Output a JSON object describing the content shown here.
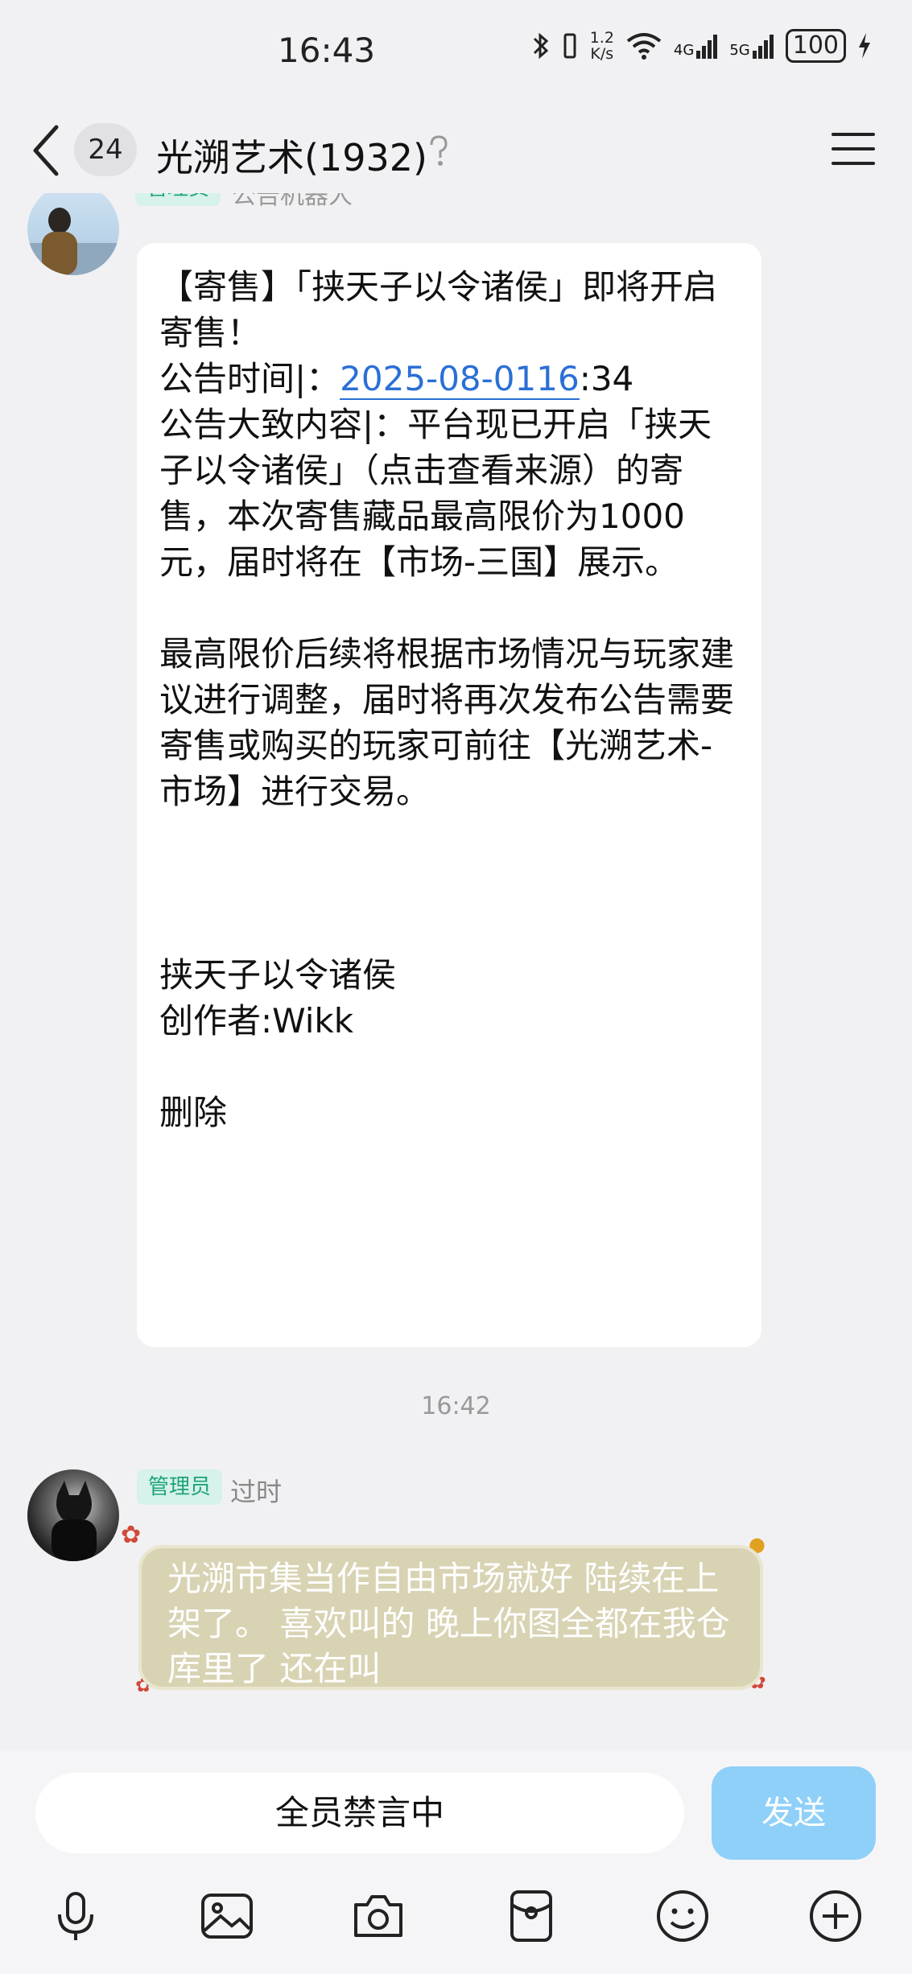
{
  "status_bar": {
    "time": "16:43",
    "speed_value": "1.2",
    "speed_unit": "K/s",
    "net1": "4G",
    "net2": "5G",
    "battery": "100"
  },
  "header": {
    "unread_count": "24",
    "title": "光溯艺术(1932)"
  },
  "messages": {
    "top": {
      "tag": "管理员",
      "sender": "公告机器人",
      "lines": {
        "l1": "【寄售】「挟天子以令诸侯」即将开启寄售！",
        "time_prefix": "公告时间|：",
        "time_link": "2025-08-0116",
        "time_suffix": ":34",
        "l3": "公告大致内容|：平台现已开启「挟天子以令诸侯」（点击查看来源）的寄售，本次寄售藏品最高限价为1000元，届时将在【市场-三国】展示。",
        "l4": "最高限价后续将根据市场情况与玩家建议进行调整，届时将再次发布公告需要寄售或购买的玩家可前往【光溯艺术-市场】进行交易。",
        "l5": "挟天子以令诸侯",
        "l6": "创作者:Wikk",
        "l7": "删除"
      }
    },
    "timestamp": "16:42",
    "bottom": {
      "tag": "管理员",
      "sender": "过时",
      "text": "光溯市集当作自由市场就好 陆续在上架了。 喜欢叫的 晚上你图全都在我仓库里了 还在叫"
    }
  },
  "input": {
    "placeholder": "全员禁言中",
    "send": "发送"
  },
  "toolbar": {
    "icons": [
      "microphone-icon",
      "image-icon",
      "camera-icon",
      "red-packet-icon",
      "emoji-icon",
      "plus-icon"
    ]
  },
  "colors": {
    "accent_link": "#2a6fd6",
    "admin_tag_bg": "#d6f2ea",
    "admin_tag_text": "#1da37c",
    "send_button": "#8fd0f8"
  }
}
